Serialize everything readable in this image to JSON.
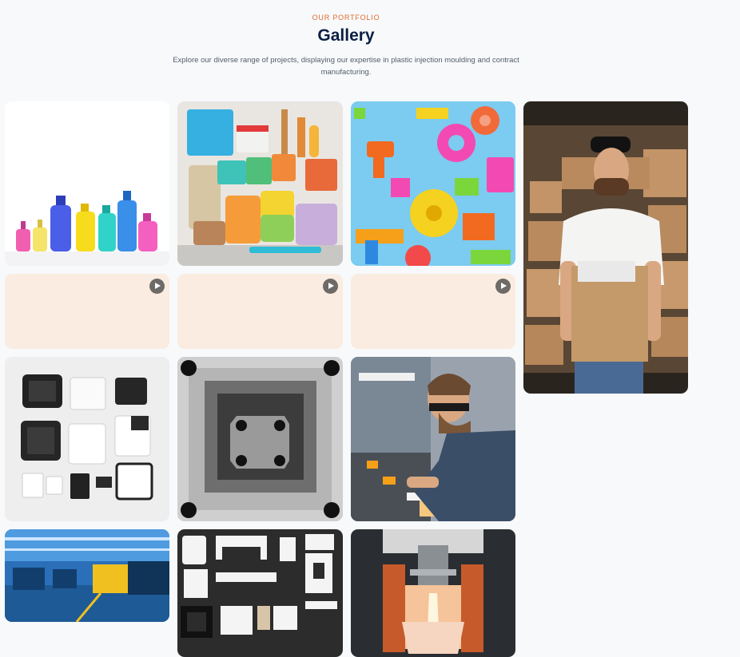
{
  "section": {
    "eyebrow": "OUR PORTFOLIO",
    "title": "Gallery",
    "subtitle": "Explore our diverse range of projects, displaying our expertise in plastic injection moulding and contract manufacturing."
  },
  "colors": {
    "accent": "#e46a2a",
    "title": "#0b1f44",
    "video_placeholder": "#fbece1"
  },
  "gallery": {
    "images": [
      {
        "subject": "colorful plastic bottles"
      },
      {
        "subject": "plastic food containers"
      },
      {
        "subject": "colorful injection moulded parts"
      },
      {
        "subject": "delivery man holding box"
      },
      {
        "subject": "black and white plastic enclosures"
      },
      {
        "subject": "steel mould cavity"
      },
      {
        "subject": "engineer inspecting parts"
      },
      {
        "subject": "injection moulding factory floor"
      },
      {
        "subject": "white plastic components on black"
      },
      {
        "subject": "molten plastic pouring machine"
      }
    ],
    "videos": [
      {
        "icon": "play-icon"
      },
      {
        "icon": "play-icon"
      },
      {
        "icon": "play-icon"
      }
    ]
  }
}
